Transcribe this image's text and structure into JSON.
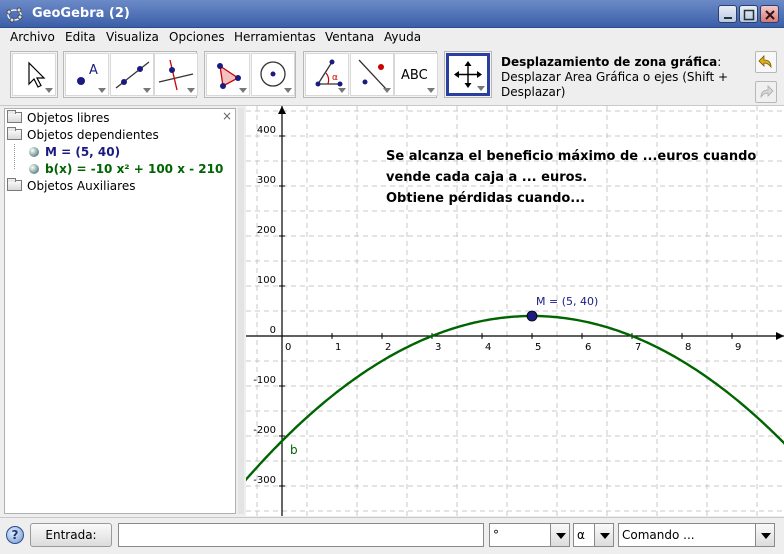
{
  "window": {
    "title": "GeoGebra (2)"
  },
  "menu": [
    "Archivo",
    "Edita",
    "Visualiza",
    "Opciones",
    "Herramientas",
    "Ventana",
    "Ayuda"
  ],
  "toolbar": {
    "text_tool_label": "ABC",
    "help_title": "Desplazamiento de zona gráfica",
    "help_colon": ":",
    "help_desc": "Desplazar Area Gráfica o ejes (Shift + Desplazar)"
  },
  "algebra": {
    "free_objects": "Objetos libres",
    "dependent_objects": "Objetos dependientes",
    "point_M": "M = (5, 40)",
    "function_b": "b(x) = -10 x² + 100 x - 210",
    "auxiliary_objects": "Objetos Auxiliares",
    "close_symbol": "×"
  },
  "graphics": {
    "text_lines": [
      "Se alcanza el beneficio máximo de ...euros cuando",
      "vende cada caja a ... euros.",
      "Obtiene pérdidas cuando..."
    ],
    "point_label": "M = (5, 40)",
    "curve_label": "b",
    "x_ticks": [
      "0",
      "1",
      "2",
      "3",
      "4",
      "5",
      "6",
      "7",
      "8",
      "9"
    ],
    "y_ticks": [
      "400",
      "300",
      "200",
      "100",
      "0",
      "-100",
      "-200",
      "-300"
    ],
    "curve_color": "#006400",
    "point_color": "#1a1a80"
  },
  "inputbar": {
    "label": "Entrada:",
    "value": "",
    "degree_symbol": "°",
    "alpha_symbol": "α",
    "command_placeholder": "Comando ..."
  }
}
